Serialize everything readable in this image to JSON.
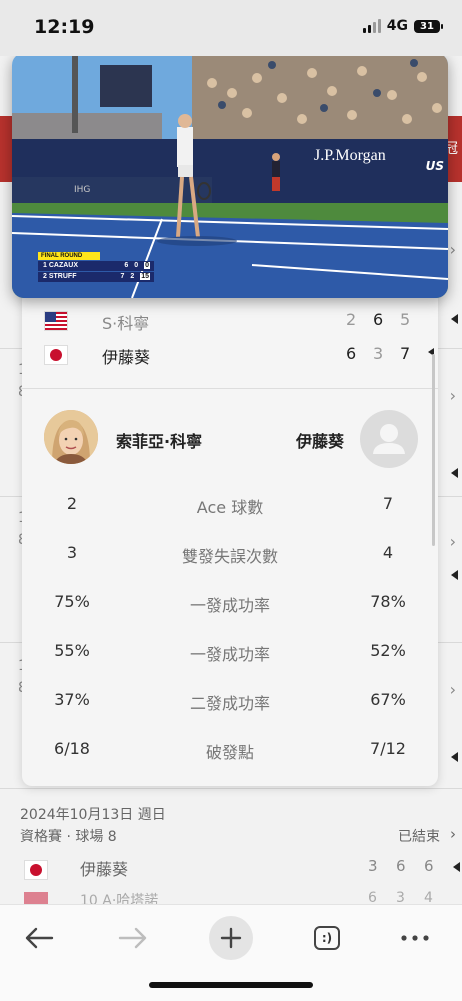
{
  "status_bar": {
    "time": "12:19",
    "network": "4G",
    "battery": "31"
  },
  "video": {
    "round_label": "FINAL ROUND",
    "sponsor_main": "J.P.Morgan",
    "sponsor_event": "US",
    "sponsor_court": "IHG",
    "players": [
      {
        "seed": "1",
        "name": "CAZAUX",
        "sets": "6 0",
        "game": "0"
      },
      {
        "seed": "2",
        "name": "STRUFF",
        "sets": "7 2",
        "game": "15"
      }
    ]
  },
  "background": {
    "banner_text": "冠",
    "match": {
      "date": "2024年10月13日 週日",
      "court": "資格賽 · 球場 8",
      "status": "已結束",
      "player1": {
        "name": "伊藤葵",
        "scores": [
          "3",
          "6",
          "6"
        ]
      },
      "player2": {
        "name": "10 A·哈塔諾",
        "scores": [
          "6",
          "3",
          "4"
        ]
      }
    },
    "side_numbers": [
      "1",
      "8",
      "1",
      "8",
      "1",
      "8"
    ]
  },
  "score_card": {
    "rows": [
      {
        "flag": "us",
        "name": "S·科寧",
        "scores": [
          "2",
          "6",
          "5"
        ]
      },
      {
        "flag": "jp",
        "name": "伊藤葵",
        "scores": [
          "6",
          "3",
          "7"
        ],
        "serving": true
      }
    ],
    "player_left": "索菲亞·科寧",
    "player_right": "伊藤葵",
    "stats": [
      {
        "left": "2",
        "label": "Ace 球數",
        "right": "7"
      },
      {
        "left": "3",
        "label": "雙發失誤次數",
        "right": "4"
      },
      {
        "left": "75%",
        "label": "一發成功率",
        "right": "78%"
      },
      {
        "left": "55%",
        "label": "一發成功率",
        "right": "52%"
      },
      {
        "left": "37%",
        "label": "二發成功率",
        "right": "67%"
      },
      {
        "left": "6/18",
        "label": "破發點",
        "right": "7/12"
      }
    ]
  },
  "toolbar": {
    "tabs_label": ":)"
  }
}
